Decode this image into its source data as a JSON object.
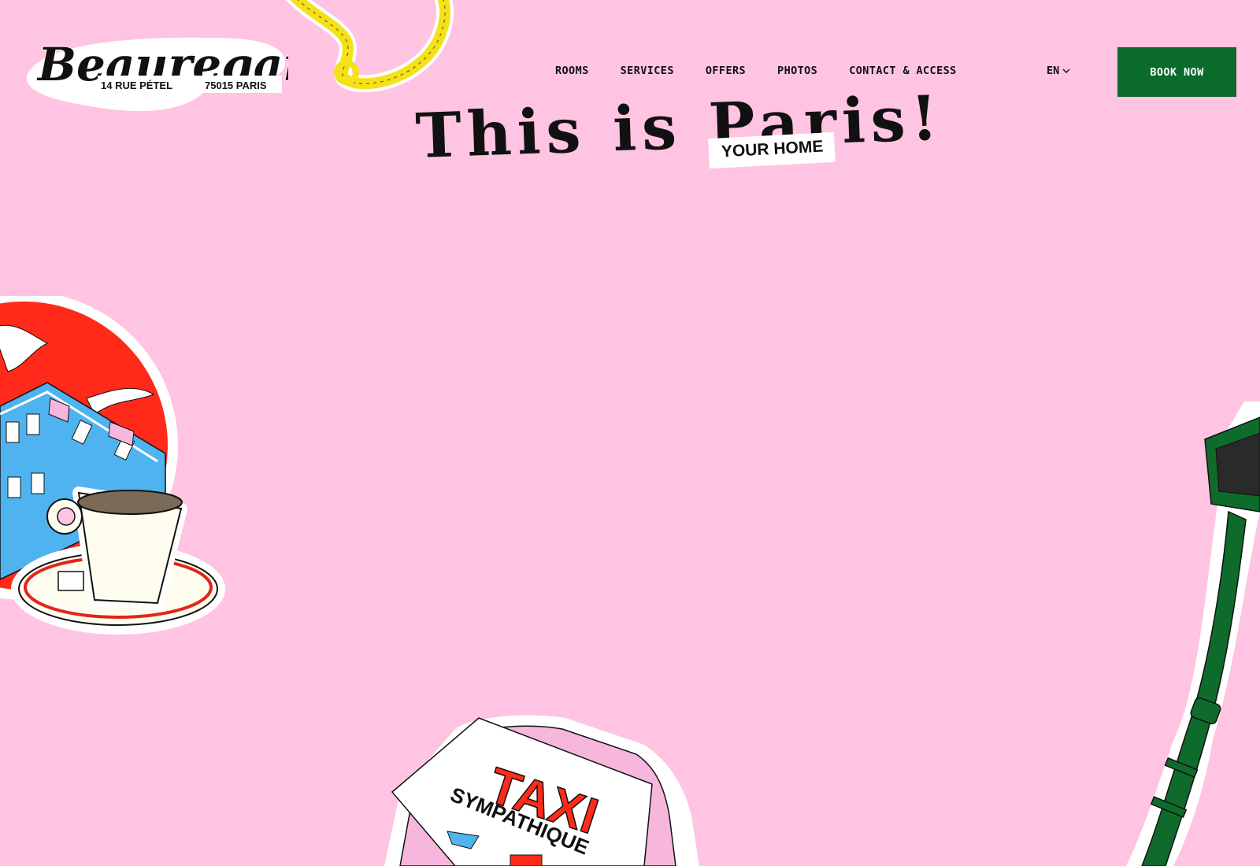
{
  "brand": {
    "name": "Beauregard",
    "address_street": "14 RUE PÉTEL",
    "address_city": "75015 PARIS"
  },
  "nav": {
    "items": [
      "ROOMS",
      "SERVICES",
      "OFFERS",
      "PHOTOS",
      "CONTACT & ACCESS"
    ],
    "language": "EN",
    "cta": "BOOK NOW"
  },
  "hero": {
    "headline": "This is Paris!",
    "badge": "YOUR HOME"
  },
  "stickers": {
    "taxi_line1": "TAXI",
    "taxi_line2": "SYMPATHIQUE"
  },
  "colors": {
    "background": "#ffc4e2",
    "cta": "#0a6b2c",
    "rope": "#f5e11a",
    "taxi_red": "#ff2a1a",
    "lamp_green": "#0f6b2c"
  },
  "icons": [
    "chevron-down-icon",
    "rope-icon",
    "coffee-cup-icon",
    "taxi-sign-icon",
    "street-lamp-icon"
  ]
}
